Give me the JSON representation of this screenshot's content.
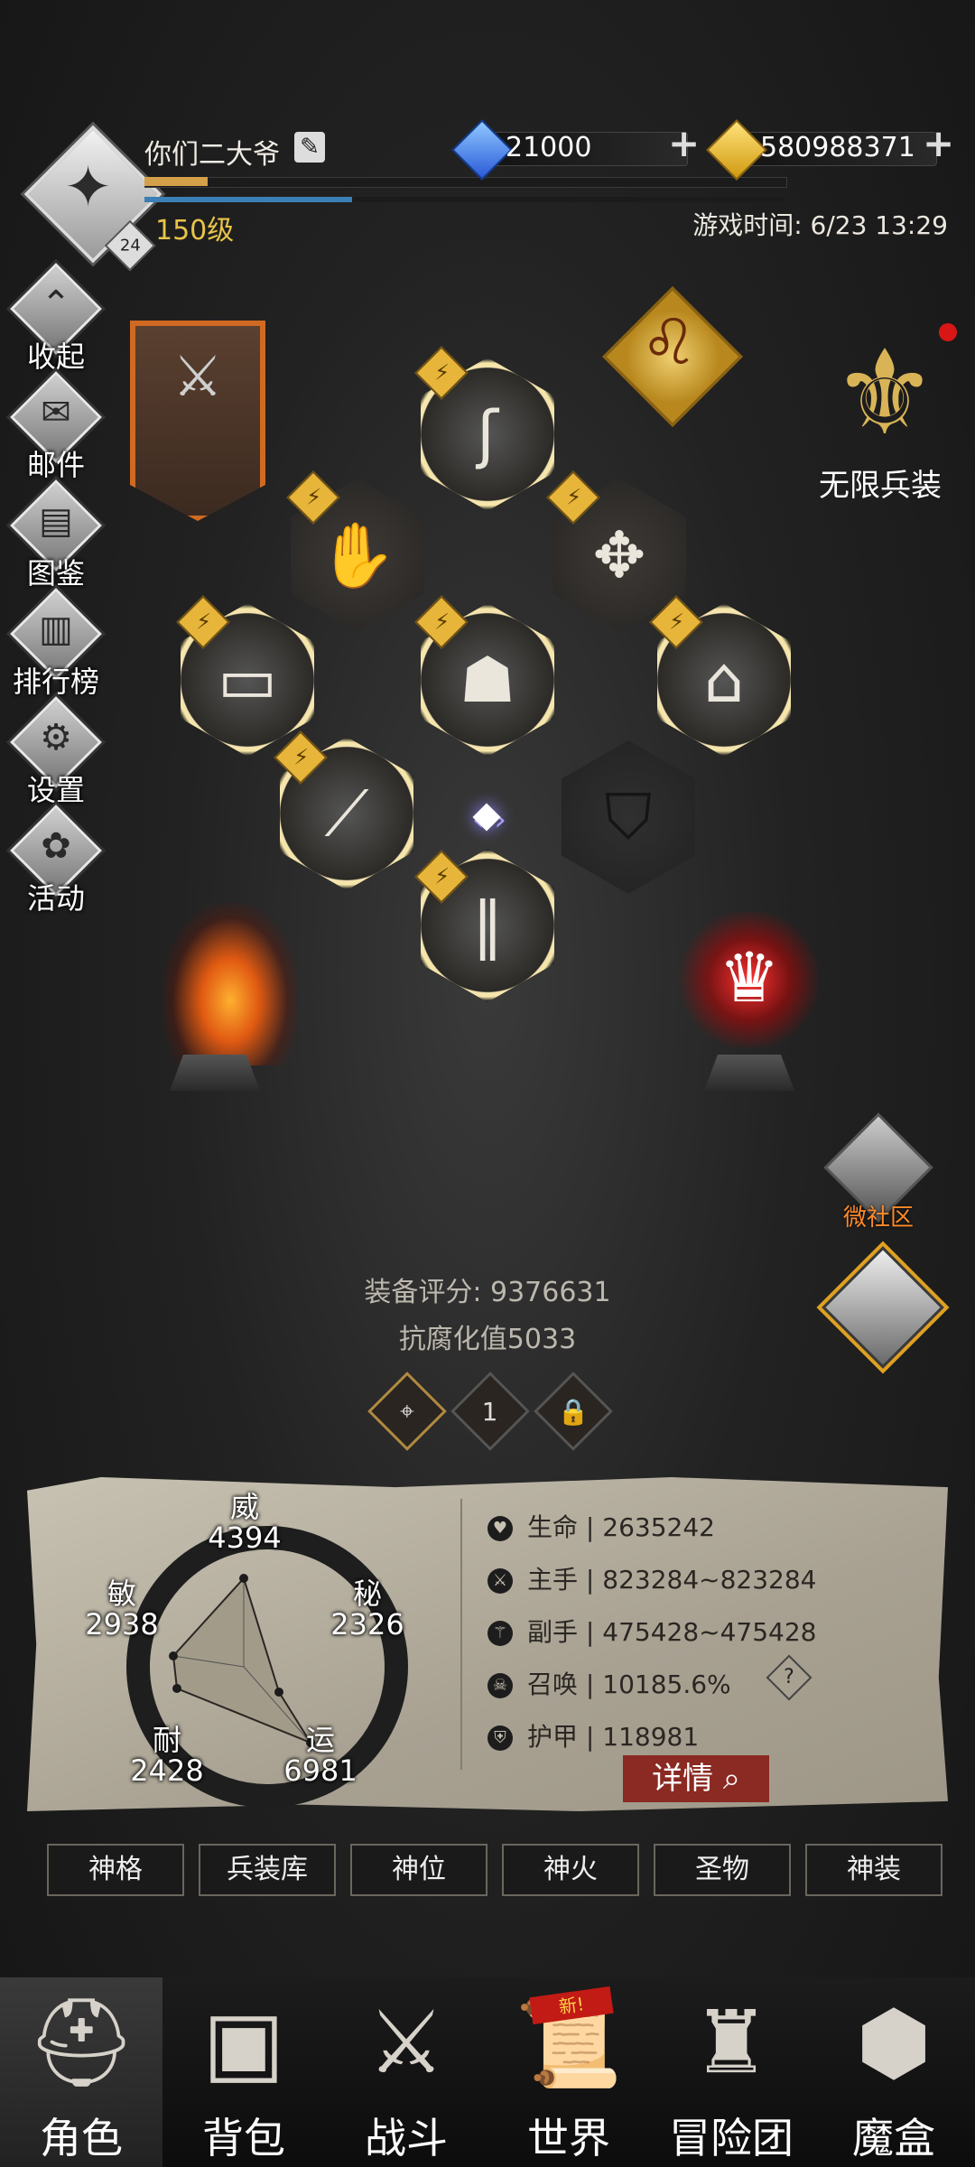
{
  "header": {
    "player_name": "你们二大爷",
    "player_level": "150级",
    "avatar_badge": "24",
    "diamonds": "21000",
    "gold": "580988371",
    "game_time": "游戏时间: 6/23 13:29"
  },
  "side_menu": [
    {
      "label": "收起",
      "icon": "collapse-icon"
    },
    {
      "label": "邮件",
      "icon": "mail-icon"
    },
    {
      "label": "图鉴",
      "icon": "book-icon"
    },
    {
      "label": "排行榜",
      "icon": "ranking-icon"
    },
    {
      "label": "设置",
      "icon": "gear-icon"
    },
    {
      "label": "活动",
      "icon": "event-icon"
    }
  ],
  "right_panel": {
    "infinite_gear_label": "无限兵装",
    "community_label": "微社区"
  },
  "equipment": {
    "score_label": "装备评分: 9376631",
    "corruption_label": "抗腐化值5033",
    "tabs": [
      "1"
    ]
  },
  "attributes": {
    "wei": {
      "name": "威",
      "value": "4394"
    },
    "mi": {
      "name": "秘",
      "value": "2326"
    },
    "min": {
      "name": "敏",
      "value": "2938"
    },
    "nai": {
      "name": "耐",
      "value": "2428"
    },
    "yun": {
      "name": "运",
      "value": "6981"
    }
  },
  "stats": [
    {
      "name": "生命",
      "value": "2635242",
      "icon": "heart-icon"
    },
    {
      "name": "主手",
      "value": "823284~823284",
      "icon": "sword-icon"
    },
    {
      "name": "副手",
      "value": "475428~475428",
      "icon": "offhand-icon"
    },
    {
      "name": "召唤",
      "value": "10185.6%",
      "icon": "summon-icon"
    },
    {
      "name": "护甲",
      "value": "118981",
      "icon": "shield-icon"
    }
  ],
  "detail_button": "详情",
  "sub_tabs": [
    "神格",
    "兵装库",
    "神位",
    "神火",
    "圣物",
    "神装"
  ],
  "bottom_nav": [
    {
      "label": "角色",
      "icon": "helmet-icon"
    },
    {
      "label": "背包",
      "icon": "backpack-icon"
    },
    {
      "label": "战斗",
      "icon": "battle-icon"
    },
    {
      "label": "世界",
      "icon": "scroll-icon"
    },
    {
      "label": "冒险团",
      "icon": "castle-icon"
    },
    {
      "label": "魔盒",
      "icon": "magic-box-icon"
    }
  ],
  "world_new_tag": "新!"
}
